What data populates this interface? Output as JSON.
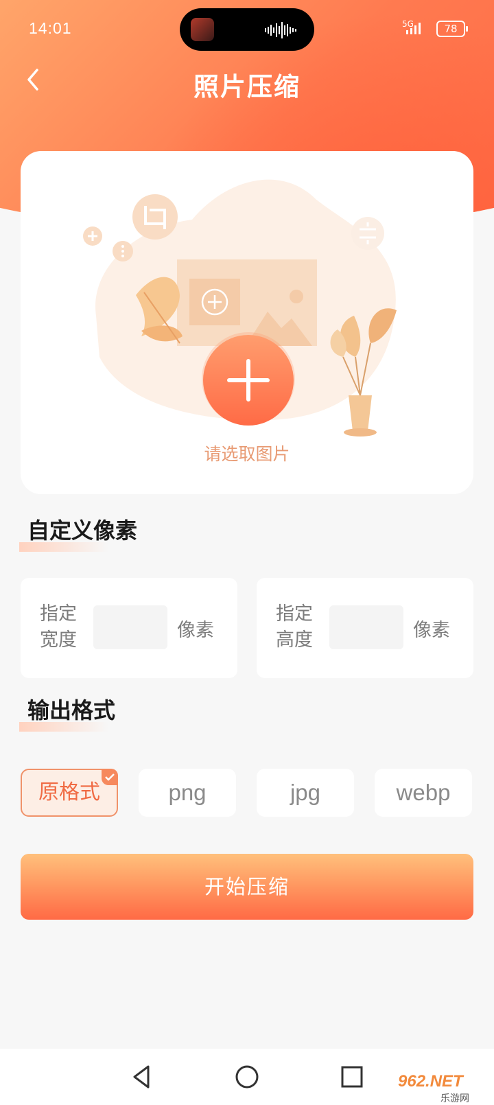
{
  "status_bar": {
    "time": "14:01",
    "network": "5G",
    "battery": "78"
  },
  "header": {
    "title": "照片压缩"
  },
  "picker": {
    "label": "请选取图片"
  },
  "custom_pixels": {
    "title": "自定义像素",
    "width": {
      "label": "指定宽度",
      "value": "",
      "unit": "像素"
    },
    "height": {
      "label": "指定高度",
      "value": "",
      "unit": "像素"
    }
  },
  "output_format": {
    "title": "输出格式",
    "options": [
      "原格式",
      "png",
      "jpg",
      "webp"
    ],
    "selected": "原格式"
  },
  "actions": {
    "start_label": "开始压缩"
  },
  "watermark": {
    "text": "962.NET",
    "subtext": "乐游网"
  },
  "colors": {
    "accent": "#ff6a45",
    "accent_light": "#ffa56a",
    "label": "#e89b74",
    "page_bg": "#f7f7f7"
  }
}
